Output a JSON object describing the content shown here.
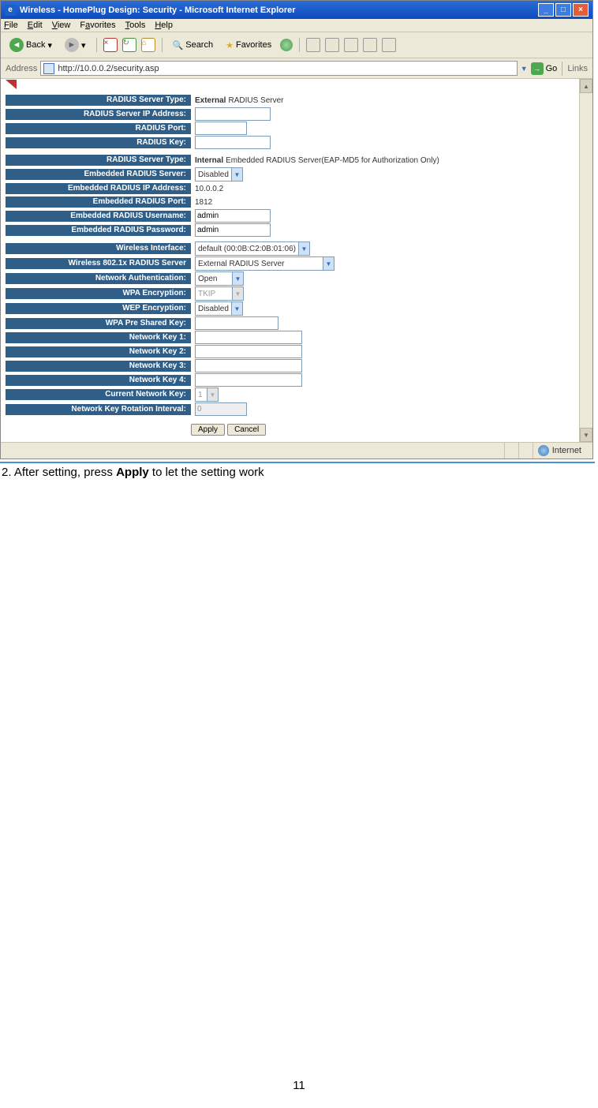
{
  "window": {
    "title": "Wireless - HomePlug Design: Security - Microsoft Internet Explorer"
  },
  "menu": {
    "file": "File",
    "edit": "Edit",
    "view": "View",
    "favorites": "Favorites",
    "tools": "Tools",
    "help": "Help"
  },
  "toolbar": {
    "back": "Back",
    "search": "Search",
    "favorites": "Favorites"
  },
  "address": {
    "label": "Address",
    "url": "http://10.0.0.2/security.asp",
    "go": "Go",
    "links": "Links"
  },
  "section1": {
    "radius_server_type_label": "RADIUS Server Type:",
    "radius_server_type_value_bold": "External",
    "radius_server_type_value_rest": " RADIUS Server",
    "radius_ip_label": "RADIUS Server IP Address:",
    "radius_port_label": "RADIUS Port:",
    "radius_key_label": "RADIUS Key:"
  },
  "section2": {
    "radius_server_type_label": "RADIUS Server Type:",
    "radius_server_type_value_bold": "Internal",
    "radius_server_type_value_rest": " Embedded RADIUS Server(EAP-MD5 for Authorization Only)",
    "embedded_server_label": "Embedded RADIUS Server:",
    "embedded_server_value": "Disabled",
    "embedded_ip_label": "Embedded RADIUS IP Address:",
    "embedded_ip_value": "10.0.0.2",
    "embedded_port_label": "Embedded RADIUS Port:",
    "embedded_port_value": "1812",
    "embedded_user_label": "Embedded RADIUS Username:",
    "embedded_user_value": "admin",
    "embedded_pass_label": "Embedded RADIUS Password:",
    "embedded_pass_value": "admin"
  },
  "section3": {
    "wifi_iface_label": "Wireless Interface:",
    "wifi_iface_value": "default (00:0B:C2:0B:01:06)",
    "radius_server_label": "Wireless 802.1x RADIUS Server",
    "radius_server_value": "External RADIUS Server",
    "net_auth_label": "Network Authentication:",
    "net_auth_value": "Open",
    "wpa_enc_label": "WPA Encryption:",
    "wpa_enc_value": "TKIP",
    "wep_enc_label": "WEP Encryption:",
    "wep_enc_value": "Disabled",
    "wpa_psk_label": "WPA Pre Shared Key:",
    "nk1_label": "Network Key 1:",
    "nk2_label": "Network Key 2:",
    "nk3_label": "Network Key 3:",
    "nk4_label": "Network Key 4:",
    "cur_key_label": "Current Network Key:",
    "cur_key_value": "1",
    "rotation_label": "Network Key Rotation Interval:",
    "rotation_value": "0"
  },
  "buttons": {
    "apply": "Apply",
    "cancel": "Cancel"
  },
  "status": {
    "zone": "Internet"
  },
  "caption": {
    "prefix": "2. After setting, press ",
    "bold": "Apply",
    "suffix": " to let the setting work"
  },
  "page_number": "11"
}
